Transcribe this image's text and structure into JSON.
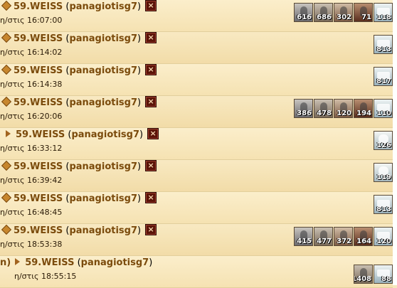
{
  "rows": [
    {
      "pre": "",
      "city": "59.WEISS",
      "player": "panagiotisg7",
      "time": "η/στις 16:07:00",
      "close": "×",
      "units": [
        {
          "type": "sword",
          "count": "616"
        },
        {
          "type": "hopl",
          "count": "686"
        },
        {
          "type": "archer",
          "count": "302"
        },
        {
          "type": "slinger",
          "count": "71"
        },
        {
          "type": "ship",
          "count": "118"
        }
      ]
    },
    {
      "pre": "",
      "city": "59.WEISS",
      "player": "panagiotisg7",
      "time": "η/στις 16:14:02",
      "close": "×",
      "units": [
        {
          "type": "ship",
          "count": "813"
        }
      ]
    },
    {
      "pre": "",
      "city": "59.WEISS",
      "player": "panagiotisg7",
      "time": "η/στις 16:14:38",
      "close": "×",
      "units": [
        {
          "type": "ship",
          "count": "817"
        }
      ]
    },
    {
      "pre": "",
      "city": "59.WEISS",
      "player": "panagiotisg7",
      "time": "η/στις 16:20:06",
      "close": "×",
      "units": [
        {
          "type": "sword",
          "count": "386"
        },
        {
          "type": "hopl",
          "count": "478"
        },
        {
          "type": "archer",
          "count": "120"
        },
        {
          "type": "slinger",
          "count": "194"
        },
        {
          "type": "ship",
          "count": "110"
        }
      ]
    },
    {
      "pre": "",
      "city": "59.WEISS",
      "player": "panagiotisg7",
      "time": "η/στις 16:33:12",
      "close": "×",
      "units": [
        {
          "type": "pegasus",
          "count": "126"
        }
      ]
    },
    {
      "pre": "",
      "city": "59.WEISS",
      "player": "panagiotisg7",
      "time": "η/στις 16:39:42",
      "close": "×",
      "units": [
        {
          "type": "pegasus",
          "count": "119"
        }
      ]
    },
    {
      "pre": "",
      "city": "59.WEISS",
      "player": "panagiotisg7",
      "time": "η/στις 16:48:45",
      "close": "×",
      "units": [
        {
          "type": "ship",
          "count": "813"
        }
      ]
    },
    {
      "pre": "",
      "city": "59.WEISS",
      "player": "panagiotisg7",
      "time": "η/στις 18:53:38",
      "close": "×",
      "units": [
        {
          "type": "sword",
          "count": "415"
        },
        {
          "type": "hopl",
          "count": "477"
        },
        {
          "type": "archer",
          "count": "372"
        },
        {
          "type": "slinger",
          "count": "164"
        },
        {
          "type": "ship",
          "count": "120"
        }
      ]
    },
    {
      "pre": "n)",
      "city": "59.WEISS",
      "player": "panagiotisg7",
      "time": "η/στις 18:55:15",
      "close": "",
      "units": [
        {
          "type": "hopl",
          "count": "1408"
        },
        {
          "type": "ship",
          "count": "88"
        }
      ]
    }
  ]
}
